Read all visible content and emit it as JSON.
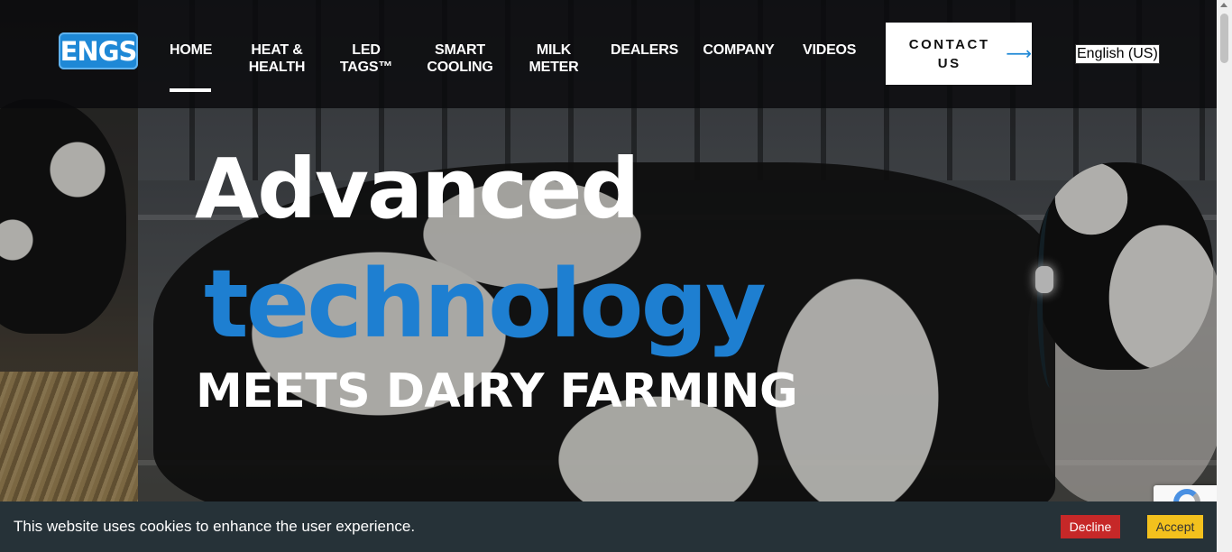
{
  "brand": {
    "logo_text": "ENGS",
    "accent_color": "#1e7fd1"
  },
  "nav": {
    "items": [
      {
        "label": "HOME",
        "active": true
      },
      {
        "label": "HEAT &\nHEALTH"
      },
      {
        "label": "LED\nTAGS™"
      },
      {
        "label": "SMART\nCOOLING"
      },
      {
        "label": "MILK\nMETER"
      },
      {
        "label": "DEALERS"
      },
      {
        "label": "COMPANY"
      },
      {
        "label": "VIDEOS"
      }
    ],
    "contact_label": "CONTACT\nUS",
    "contact_icon": "arrow-right-icon",
    "language": "English (US)"
  },
  "hero": {
    "line1": "Advanced",
    "line2": "technology",
    "line3": "MEETS DAIRY FARMING"
  },
  "cookie": {
    "message": "This website uses cookies to enhance the user experience.",
    "decline_label": "Decline",
    "accept_label": "Accept",
    "decline_color": "#c62828",
    "accept_color": "#f3c11d"
  }
}
